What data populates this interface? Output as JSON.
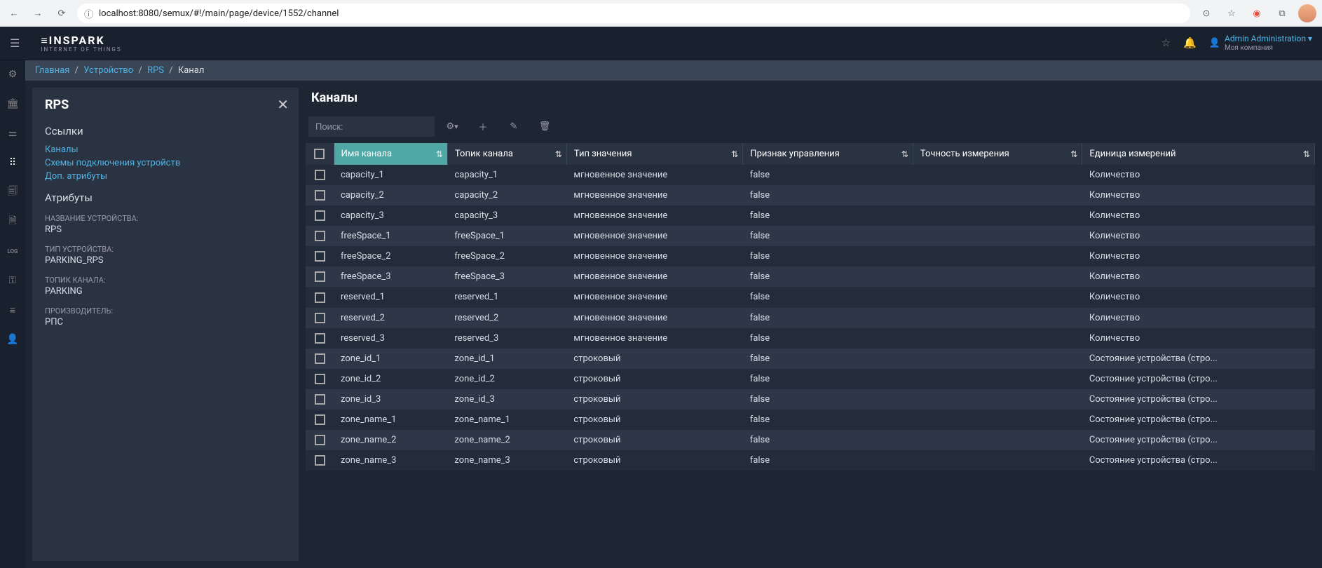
{
  "browser": {
    "url": "localhost:8080/semux/#!/main/page/device/1552/channel"
  },
  "logo": {
    "main": "≡INSPARK",
    "sub": "INTERNET OF THINGS"
  },
  "user": {
    "name": "Admin Administration",
    "company": "Моя компания"
  },
  "breadcrumb": {
    "home": "Главная",
    "device": "Устройство",
    "rps": "RPS",
    "current": "Канал"
  },
  "sidepanel": {
    "title": "RPS",
    "links_title": "Ссылки",
    "links": [
      "Каналы",
      "Схемы подключения устройств",
      "Доп. атрибуты"
    ],
    "attrs_title": "Атрибуты",
    "attrs": [
      {
        "label": "НАЗВАНИЕ УСТРОЙСТВА:",
        "value": "RPS"
      },
      {
        "label": "ТИП УСТРОЙСТВА:",
        "value": "PARKING_RPS"
      },
      {
        "label": "ТОПИК КАНАЛА:",
        "value": "PARKING"
      },
      {
        "label": "ПРОИЗВОДИТЕЛЬ:",
        "value": "РПС"
      }
    ]
  },
  "main": {
    "title": "Каналы",
    "search_placeholder": "Поиск:",
    "columns": [
      "Имя канала",
      "Топик канала",
      "Тип значения",
      "Признак управления",
      "Точность измерения",
      "Единица измерений"
    ],
    "rows": [
      {
        "name": "capacity_1",
        "topic": "capacity_1",
        "vtype": "мгновенное значение",
        "ctrl": "false",
        "prec": "",
        "unit": "Количество"
      },
      {
        "name": "capacity_2",
        "topic": "capacity_2",
        "vtype": "мгновенное значение",
        "ctrl": "false",
        "prec": "",
        "unit": "Количество"
      },
      {
        "name": "capacity_3",
        "topic": "capacity_3",
        "vtype": "мгновенное значение",
        "ctrl": "false",
        "prec": "",
        "unit": "Количество"
      },
      {
        "name": "freeSpace_1",
        "topic": "freeSpace_1",
        "vtype": "мгновенное значение",
        "ctrl": "false",
        "prec": "",
        "unit": "Количество"
      },
      {
        "name": "freeSpace_2",
        "topic": "freeSpace_2",
        "vtype": "мгновенное значение",
        "ctrl": "false",
        "prec": "",
        "unit": "Количество"
      },
      {
        "name": "freeSpace_3",
        "topic": "freeSpace_3",
        "vtype": "мгновенное значение",
        "ctrl": "false",
        "prec": "",
        "unit": "Количество"
      },
      {
        "name": "reserved_1",
        "topic": "reserved_1",
        "vtype": "мгновенное значение",
        "ctrl": "false",
        "prec": "",
        "unit": "Количество"
      },
      {
        "name": "reserved_2",
        "topic": "reserved_2",
        "vtype": "мгновенное значение",
        "ctrl": "false",
        "prec": "",
        "unit": "Количество"
      },
      {
        "name": "reserved_3",
        "topic": "reserved_3",
        "vtype": "мгновенное значение",
        "ctrl": "false",
        "prec": "",
        "unit": "Количество"
      },
      {
        "name": "zone_id_1",
        "topic": "zone_id_1",
        "vtype": "строковый",
        "ctrl": "false",
        "prec": "",
        "unit": "Состояние устройства (стро..."
      },
      {
        "name": "zone_id_2",
        "topic": "zone_id_2",
        "vtype": "строковый",
        "ctrl": "false",
        "prec": "",
        "unit": "Состояние устройства (стро..."
      },
      {
        "name": "zone_id_3",
        "topic": "zone_id_3",
        "vtype": "строковый",
        "ctrl": "false",
        "prec": "",
        "unit": "Состояние устройства (стро..."
      },
      {
        "name": "zone_name_1",
        "topic": "zone_name_1",
        "vtype": "строковый",
        "ctrl": "false",
        "prec": "",
        "unit": "Состояние устройства (стро..."
      },
      {
        "name": "zone_name_2",
        "topic": "zone_name_2",
        "vtype": "строковый",
        "ctrl": "false",
        "prec": "",
        "unit": "Состояние устройства (стро..."
      },
      {
        "name": "zone_name_3",
        "topic": "zone_name_3",
        "vtype": "строковый",
        "ctrl": "false",
        "prec": "",
        "unit": "Состояние устройства (стро..."
      }
    ]
  }
}
